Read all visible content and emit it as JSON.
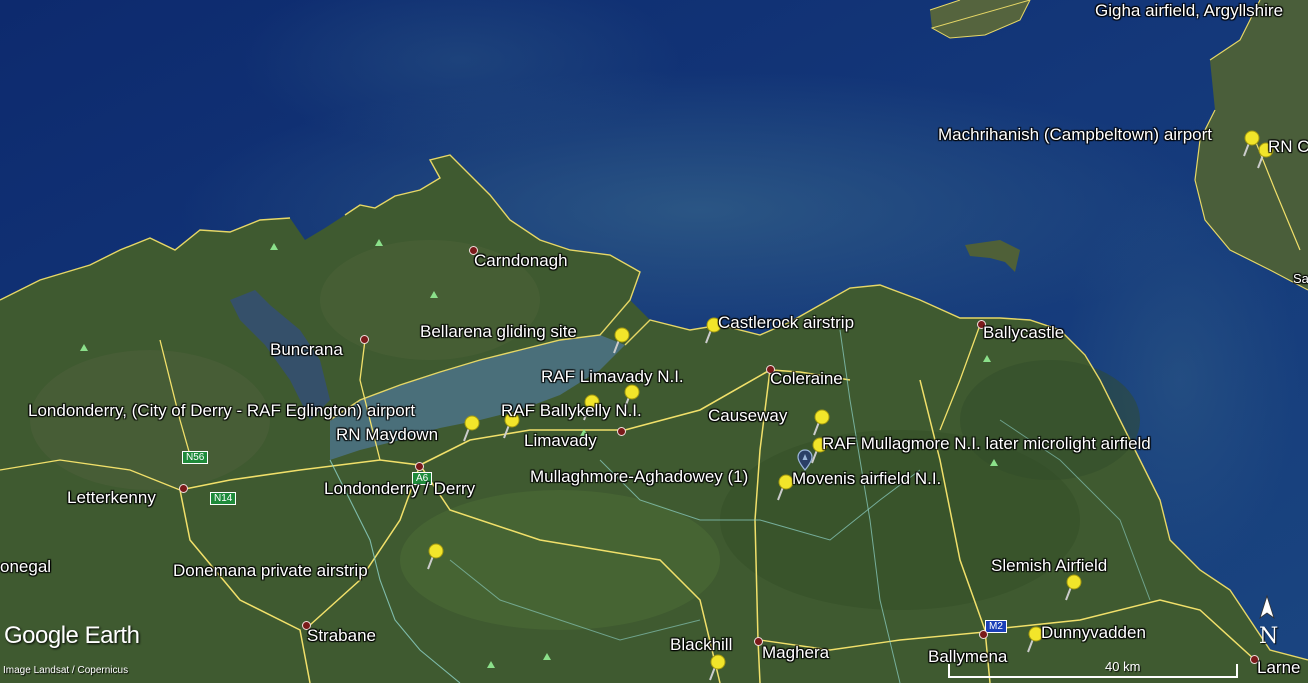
{
  "map": {
    "colors": {
      "sea": "#0c2a66",
      "land": "#3d5a2e",
      "road": "#f1e06a",
      "border": "#8fd3c9",
      "pin": "#f2e52a"
    }
  },
  "labels": {
    "gigha": "Gigha airfield, Argyllshire",
    "machrihanish": "Machrihanish (Campbeltown) airport",
    "rnc": "RN C",
    "carndonagh": "Carndonagh",
    "bellarena": "Bellarena gliding site",
    "castlerock": "Castlerock airstrip",
    "ballycastle": "Ballycastle",
    "buncrana": "Buncrana",
    "raf_limavady": "RAF Limavady N.I.",
    "coleraine": "Coleraine",
    "eglinton": "Londonderry,  (City of Derry - RAF Eglington) airport",
    "ballykelly": "RAF Ballykelly N.I.",
    "causeway": "Causeway",
    "rn_maydown": "RN Maydown",
    "limavady": "Limavady",
    "mullagmore": "RAF Mullagmore N.I. later microlight airfield",
    "mullaghmore_agh": "Mullaghmore-Aghadowey (1)",
    "movenis": "Movenis airfield N.I.",
    "letterkenny": "Letterkenny",
    "derry": "Londonderry / Derry",
    "donegal": "onegal",
    "donemana": "Donemana private airstrip",
    "slemish": "Slemish Airfield",
    "strabane": "Strabane",
    "blackhill": "Blackhill",
    "maghera": "Maghera",
    "dunnyvadden": "Dunnyvadden",
    "ballymena": "Ballymena",
    "larne": "Larne",
    "sa": "Sa"
  },
  "roads": {
    "n56": "N56",
    "n14": "N14",
    "a6": "A6",
    "m2": "M2"
  },
  "overlay": {
    "logo_google": "Google",
    "logo_earth": "Earth",
    "credit": "Image Landsat / Copernicus",
    "scale": "40 km",
    "north": "N"
  }
}
